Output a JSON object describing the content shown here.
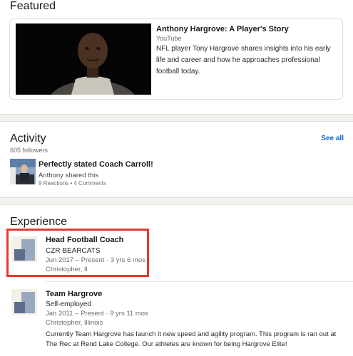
{
  "featured": {
    "section_title": "Featured",
    "item": {
      "title": "Anthony Hargrove: A Player's Story",
      "source": "YouTube",
      "description": "NFL player Tony Hargrove shares insights into his early life and career and how he approaches professional football today."
    }
  },
  "activity": {
    "section_title": "Activity",
    "see_all_label": "See all",
    "followers": "605 followers",
    "post": {
      "title": "Perfectly stated Coach Carroll!",
      "shared_by": "Anthony shared this",
      "stats": "9 Reactions • 4 Comments"
    }
  },
  "experience": {
    "section_title": "Experience",
    "highlight_color": "#e8392b",
    "items": [
      {
        "role": "Head Football Coach",
        "company": "CZR BEARCATS",
        "dates": "Jun 2017 – Present · 3 yrs 6 mos",
        "location": "Christopher, Il"
      },
      {
        "role": "Team Hargrove",
        "company": "Self-employed",
        "dates": "Jan 2011 – Present · 9 yrs 11 mos",
        "location": "Christopher, Illinois",
        "description": "Currently Team Hargrove has launch it new speed and agility program. This program is ran out at The Rec at Rend Lake College. Our athletes are known for being Hargrove Elite!"
      }
    ]
  },
  "colors": {
    "link": "#0a66c2",
    "page_bg": "#f3f2ef"
  }
}
